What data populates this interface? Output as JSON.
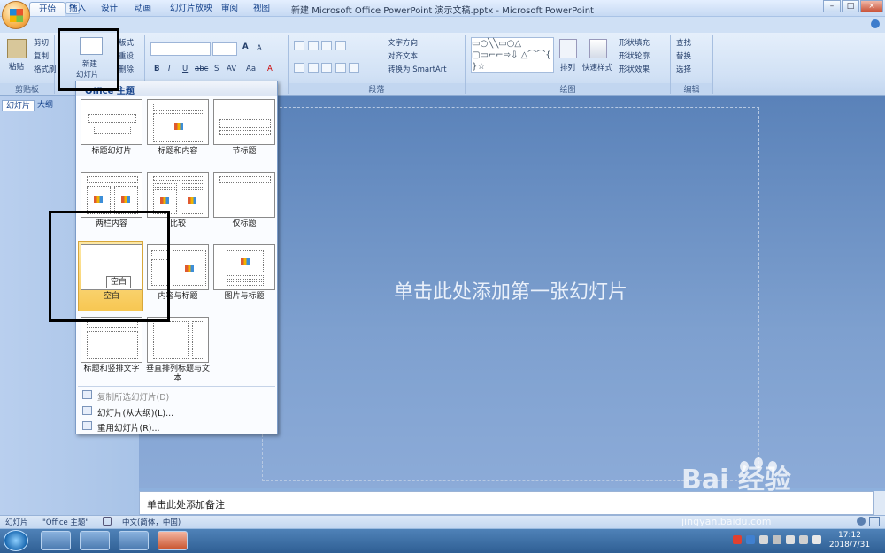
{
  "window": {
    "title": "新建 Microsoft Office PowerPoint 演示文稿.pptx - Microsoft PowerPoint",
    "min": "–",
    "max": "□",
    "close": "×"
  },
  "tabs": [
    "开始",
    "插入",
    "设计",
    "动画",
    "幻灯片放映",
    "审阅",
    "视图"
  ],
  "ribbon": {
    "clipboard": {
      "label": "剪贴板",
      "paste": "粘贴",
      "cut": "剪切",
      "copy": "复制",
      "format_painter": "格式刷"
    },
    "slides": {
      "new_slide": "新建",
      "new_slide2": "幻灯片",
      "layout": "版式",
      "reset": "重设",
      "delete": "删除"
    },
    "font": {
      "bold": "B",
      "italic": "I",
      "underline": "U",
      "strike": "abc",
      "shadow": "S",
      "spacing": "AV",
      "case": "Aa",
      "grow": "A",
      "shrink": "A"
    },
    "paragraph": {
      "label": "段落",
      "text_direction": "文字方向",
      "align_text": "对齐文本",
      "smartart": "转换为 SmartArt"
    },
    "drawing": {
      "label": "绘图",
      "arrange": "排列",
      "quick_styles": "快速样式",
      "shape_fill": "形状填充",
      "shape_outline": "形状轮廓",
      "shape_effects": "形状效果"
    },
    "editing": {
      "label": "编辑",
      "find": "查找",
      "replace": "替换",
      "select": "选择"
    }
  },
  "panel_tabs": [
    "幻灯片",
    "大纲"
  ],
  "layout_menu": {
    "header": "Office 主题",
    "layouts": [
      "标题幻灯片",
      "标题和内容",
      "节标题",
      "两栏内容",
      "比较",
      "仅标题",
      "空白",
      "内容与标题",
      "图片与标题",
      "标题和竖排文字",
      "垂直排列标题与文本"
    ],
    "tooltip": "空白",
    "items": [
      {
        "label": "复制所选幻灯片(D)",
        "disabled": true
      },
      {
        "label": "幻灯片(从大纲)(L)...",
        "disabled": false
      },
      {
        "label": "重用幻灯片(R)...",
        "disabled": false
      }
    ]
  },
  "slide": {
    "placeholder": "单击此处添加第一张幻灯片",
    "notes": "单击此处添加备注"
  },
  "status": {
    "slide": "幻灯片",
    "theme": "\"Office 主题\"",
    "language": "中文(简体，中国)"
  },
  "taskbar": {
    "time": "17:12",
    "date": "2018/7/31"
  },
  "watermark": {
    "brand": "Bai 经验",
    "url": "jingyan.baidu.com"
  }
}
